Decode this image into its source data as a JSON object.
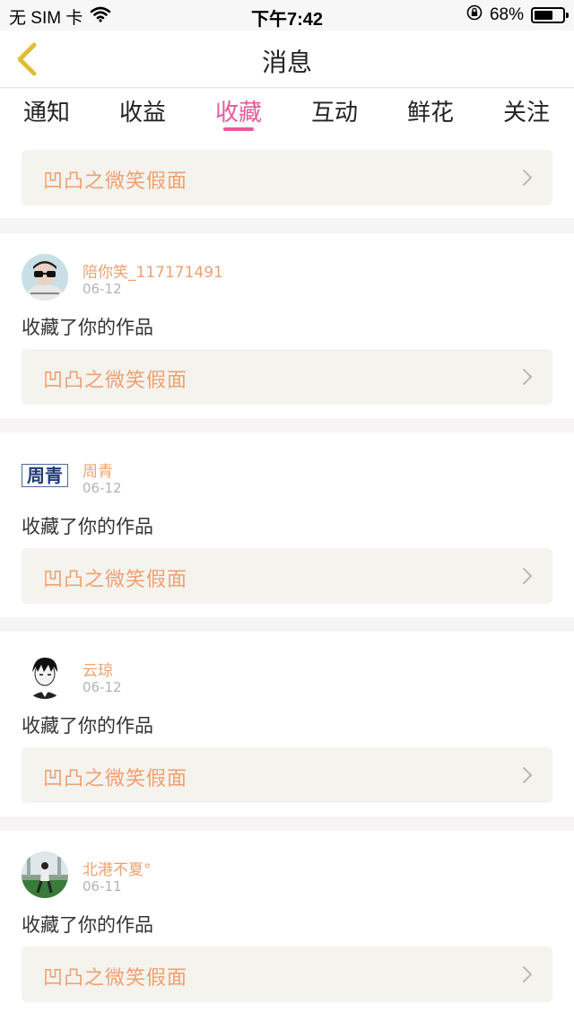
{
  "status_bar": {
    "carrier": "无 SIM 卡",
    "time": "下午7:42",
    "battery_percent_text": "68%",
    "battery_level": 0.68
  },
  "nav": {
    "title": "消息",
    "back_icon": "chevron-left-icon",
    "accent_color": "#e2c23b"
  },
  "tabs": [
    {
      "label": "通知"
    },
    {
      "label": "收益"
    },
    {
      "label": "收藏",
      "active": true
    },
    {
      "label": "互动"
    },
    {
      "label": "鲜花"
    },
    {
      "label": "关注"
    }
  ],
  "colors": {
    "active_tab": "#e55a9b",
    "name_and_work": "#f0a070",
    "date": "#b3b3b3"
  },
  "first_card": {
    "work_title": "凹凸之微笑假面"
  },
  "items": [
    {
      "username": "陪你笑_117171491",
      "date": "06-12",
      "action": "收藏了你的作品",
      "work_title": "凹凸之微笑假面"
    },
    {
      "username": "周青",
      "avatar_text": "周青",
      "date": "06-12",
      "action": "收藏了你的作品",
      "work_title": "凹凸之微笑假面"
    },
    {
      "username": "云琼",
      "date": "06-12",
      "action": "收藏了你的作品",
      "work_title": "凹凸之微笑假面"
    },
    {
      "username": "北港不夏°",
      "date": "06-11",
      "action": "收藏了你的作品",
      "work_title": "凹凸之微笑假面"
    }
  ]
}
